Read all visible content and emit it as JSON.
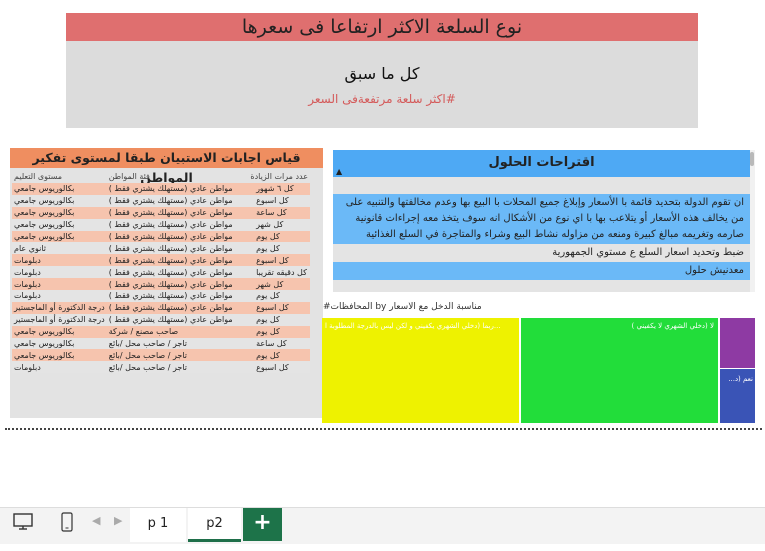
{
  "header": {
    "title": "نوع السلعة الاكثر ارتفاعا فى سعرها",
    "main_value": "كل ما سبق",
    "sub_label": "اكثر سلعة مرتفعةفى السعر#"
  },
  "table": {
    "title": "قياس اجابات الاستبيان طبقا لمستوى تفكير المواطن",
    "columns": [
      "عدد مرات الزيادة",
      "فئة المواطن",
      "مستوى التعليم"
    ],
    "rows": [
      [
        "كل ٦ شهور",
        "مواطن عادي (مستهلك يشتري فقط )",
        "بكالوريوس جامعي"
      ],
      [
        "كل اسبوع",
        "مواطن عادي (مستهلك يشتري فقط )",
        "بكالوريوس جامعي"
      ],
      [
        "كل ساعة",
        "مواطن عادي (مستهلك يشتري فقط )",
        "بكالوريوس جامعي"
      ],
      [
        "كل شهر",
        "مواطن عادي (مستهلك يشتري فقط )",
        "بكالوريوس جامعي"
      ],
      [
        "كل يوم",
        "مواطن عادي (مستهلك يشتري فقط )",
        "بكالوريوس جامعي"
      ],
      [
        "كل يوم",
        "مواطن عادي (مستهلك يشتري فقط )",
        "ثانوي عام"
      ],
      [
        "كل اسبوع",
        "مواطن عادي (مستهلك يشتري فقط )",
        "دبلومات"
      ],
      [
        "كل دقيقه تقريبا",
        "مواطن عادي (مستهلك يشتري فقط )",
        "دبلومات"
      ],
      [
        "كل شهر",
        "مواطن عادي (مستهلك يشتري فقط )",
        "دبلومات"
      ],
      [
        "كل يوم",
        "مواطن عادي (مستهلك يشتري فقط )",
        "دبلومات"
      ],
      [
        "كل اسبوع",
        "مواطن عادي (مستهلك يشتري فقط )",
        "درجة الدكتورة أو الماجستير"
      ],
      [
        "كل يوم",
        "مواطن عادي (مستهلك يشتري فقط )",
        "درجة الدكتورة أو الماجستير"
      ],
      [
        "كل يوم",
        "صاحب مصنع / شركة",
        "بكالوريوس جامعي"
      ],
      [
        "كل ساعة",
        "تاجر / صاحب محل /بائع",
        "بكالوريوس جامعي"
      ],
      [
        "كل يوم",
        "تاجر / صاحب محل /بائع",
        "بكالوريوس جامعي"
      ],
      [
        "كل اسبوع",
        "تاجر / صاحب محل /بائع",
        "دبلومات"
      ]
    ]
  },
  "suggestions": {
    "title": "اقتراحات الحلول",
    "items": [
      "ان تقوم الدولة بتحديد قائمة با الأسعار وإبلاغ جميع المحلات با البيع بها وعدم مخالفتها والتنبيه على من يخالف هذه الأسعار أو يتلاعب بها با اي نوع من الأشكال انه سوف يتخذ معه إجراءات قانونية صارمه وتغريمه مبالغ كبيرة ومنعه من مزاوله نشاط البيع وشراء والمتاجرة في السلع الغذائية",
      "ضبط وتحديد اسعار السلع ع مستوي الجمهورية",
      "معدنيش حلول"
    ]
  },
  "treemap": {
    "title": "مناسبة الدخل مع الاسعار by المحافظات#",
    "cells": [
      {
        "label": "...ربما (دخلي الشهري يكفيني و لكن ليس بالدرجة المطلوبة ا",
        "color": "#eef200"
      },
      {
        "label": "لا (دخلي الشهري لا يكفيني )",
        "color": "#22dd3a"
      },
      {
        "label": "",
        "color": "#8e3aa3"
      },
      {
        "label": "نعم (د...",
        "color": "#3a54b6"
      }
    ]
  },
  "tabs": {
    "page1": "p 1",
    "page2": "p2",
    "add_label": "+"
  }
}
